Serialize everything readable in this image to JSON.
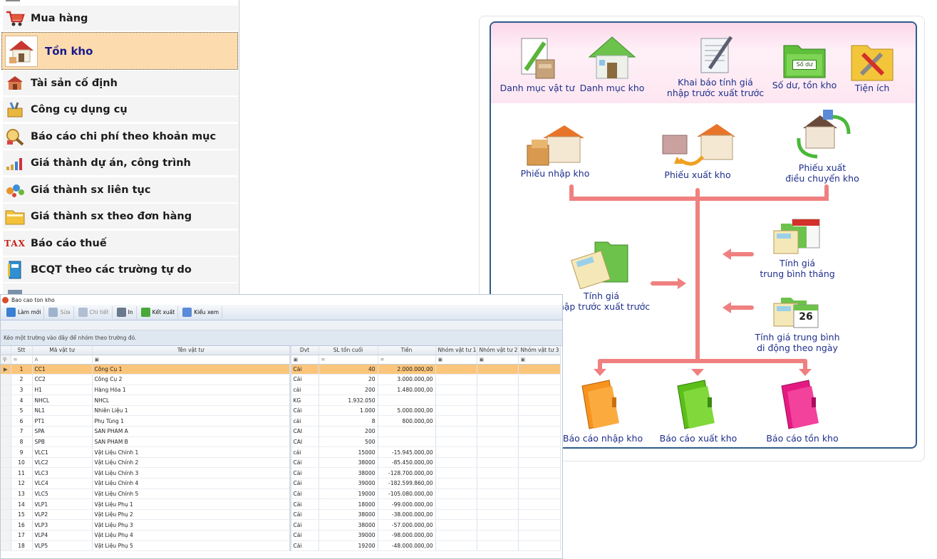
{
  "left_menu": {
    "items": [
      {
        "label": "Mua hàng",
        "icon": "shopping-cart-icon"
      },
      {
        "label": "Tồn kho",
        "icon": "warehouse-house-icon",
        "active": true
      },
      {
        "label": "Tài sản cố định",
        "icon": "fixed-asset-icon"
      },
      {
        "label": "Công cụ dụng cụ",
        "icon": "tools-icon"
      },
      {
        "label": "Báo cáo chi phí theo khoản mục",
        "icon": "cost-report-icon"
      },
      {
        "label": "Giá thành dự án, công trình",
        "icon": "bar-chart-icon"
      },
      {
        "label": "Giá thành sx liên tục",
        "icon": "gears-icon"
      },
      {
        "label": "Giá thành sx theo đơn hàng",
        "icon": "folder-icon"
      },
      {
        "label": "Báo cáo thuế",
        "icon": "tax-icon",
        "icon_text": "TAX"
      },
      {
        "label": "BCQT theo các trường tự do",
        "icon": "binder-icon"
      }
    ]
  },
  "workflow": {
    "top_items": [
      {
        "label": "Danh mục vật tư"
      },
      {
        "label": "Danh mục kho"
      },
      {
        "label_line1": "Khai báo tính giá",
        "label_line2": "nhập trước xuất trước"
      },
      {
        "label": "Số dư, tồn kho",
        "icon_text": "Số dư"
      },
      {
        "label": "Tiện ích"
      }
    ],
    "vouchers": [
      {
        "label": "Phiếu nhập kho"
      },
      {
        "label": "Phiếu xuất kho"
      },
      {
        "label_line1": "Phiếu xuất",
        "label_line2": "điều chuyển  kho"
      }
    ],
    "pricing": {
      "fifo_line1": "Tính giá",
      "fifo_line2": "nhập trước xuất trước",
      "monthly_line1": "Tính giá",
      "monthly_line2": "trung bình tháng",
      "moving_line1": "Tính giá trung bình",
      "moving_line2": "di động theo ngày",
      "calendar_day": "26"
    },
    "reports": [
      {
        "label": "Báo cáo nhập kho",
        "color": "#f7931e"
      },
      {
        "label": "Báo cáo xuất kho",
        "color": "#6cc91e"
      },
      {
        "label": "Báo cáo tồn kho",
        "color": "#ea2a8b"
      }
    ],
    "colors": {
      "connector": "#f08080",
      "band": "#fbd7ea",
      "border": "#2d5b89",
      "label": "#1f2f8c"
    }
  },
  "grid_window": {
    "title": "Bao cao ton kho",
    "toolbar": [
      {
        "label": "Làm mới",
        "enabled": true
      },
      {
        "label": "Sửa",
        "enabled": false
      },
      {
        "label": "Chi tiết",
        "enabled": false
      },
      {
        "label": "In",
        "enabled": true
      },
      {
        "label": "Kết xuất",
        "enabled": true
      },
      {
        "label": "Kiểu xem",
        "enabled": true
      }
    ],
    "group_hint": "Kéo một trường vào đây để nhóm theo trường đó.",
    "columns": [
      "Stt",
      "Mã vật tư",
      "Tên vật tư",
      "Dvt",
      "SL tồn cuối",
      "Tiền",
      "Nhóm vật tư 1",
      "Nhóm vật tư 2",
      "Nhóm vật tư 3"
    ],
    "filter_tokens": {
      "eq": "=",
      "abc": "A",
      "box": "▣",
      "dd": "▾"
    },
    "rows": [
      [
        "1",
        "CC1",
        "Công Cụ 1",
        "Cái",
        "40",
        "2.000.000,00"
      ],
      [
        "2",
        "CC2",
        "Công Cụ 2",
        "Cái",
        "20",
        "3.000.000,00"
      ],
      [
        "3",
        "H1",
        "Hàng Hóa 1",
        "cái",
        "200",
        "1.480.000,00"
      ],
      [
        "4",
        "NHCL",
        "NHCL",
        "KG",
        "1.932.050",
        ""
      ],
      [
        "5",
        "NL1",
        "Nhiên Liệu 1",
        "Cái",
        "1.000",
        "5.000.000,00"
      ],
      [
        "6",
        "PT1",
        "Phụ Tùng 1",
        "cái",
        "8",
        "800.000,00"
      ],
      [
        "7",
        "SPA",
        "SAN PHAM A",
        "CAI",
        "200",
        ""
      ],
      [
        "8",
        "SPB",
        "SAN PHAM B",
        "CAI",
        "500",
        ""
      ],
      [
        "9",
        "VLC1",
        "Vật Liệu Chính 1",
        "cái",
        "15000",
        "-15.945.000,00"
      ],
      [
        "10",
        "VLC2",
        "Vật Liệu Chính 2",
        "Cái",
        "38000",
        "-85.450.000,00"
      ],
      [
        "11",
        "VLC3",
        "Vật Liệu Chính 3",
        "Cái",
        "38000",
        "-128.700.000,00"
      ],
      [
        "12",
        "VLC4",
        "Vật Liệu Chính 4",
        "Cái",
        "39000",
        "-182.599.860,00"
      ],
      [
        "13",
        "VLC5",
        "Vật Liệu Chính 5",
        "Cái",
        "19000",
        "-105.080.000,00"
      ],
      [
        "14",
        "VLP1",
        "Vật Liệu Phụ 1",
        "Cái",
        "18000",
        "-99.000.000,00"
      ],
      [
        "15",
        "VLP2",
        "Vật Liệu Phụ 2",
        "Cái",
        "38000",
        "-38.000.000,00"
      ],
      [
        "16",
        "VLP3",
        "Vật Liệu Phụ 3",
        "Cái",
        "38000",
        "-57.000.000,00"
      ],
      [
        "17",
        "VLP4",
        "Vật Liệu Phụ 4",
        "Cái",
        "39000",
        "-98.000.000,00"
      ],
      [
        "18",
        "VLP5",
        "Vật Liệu Phụ 5",
        "Cái",
        "19200",
        "-48.000.000,00"
      ]
    ],
    "selected_row": 0,
    "selection_color": "#fbc57c"
  }
}
